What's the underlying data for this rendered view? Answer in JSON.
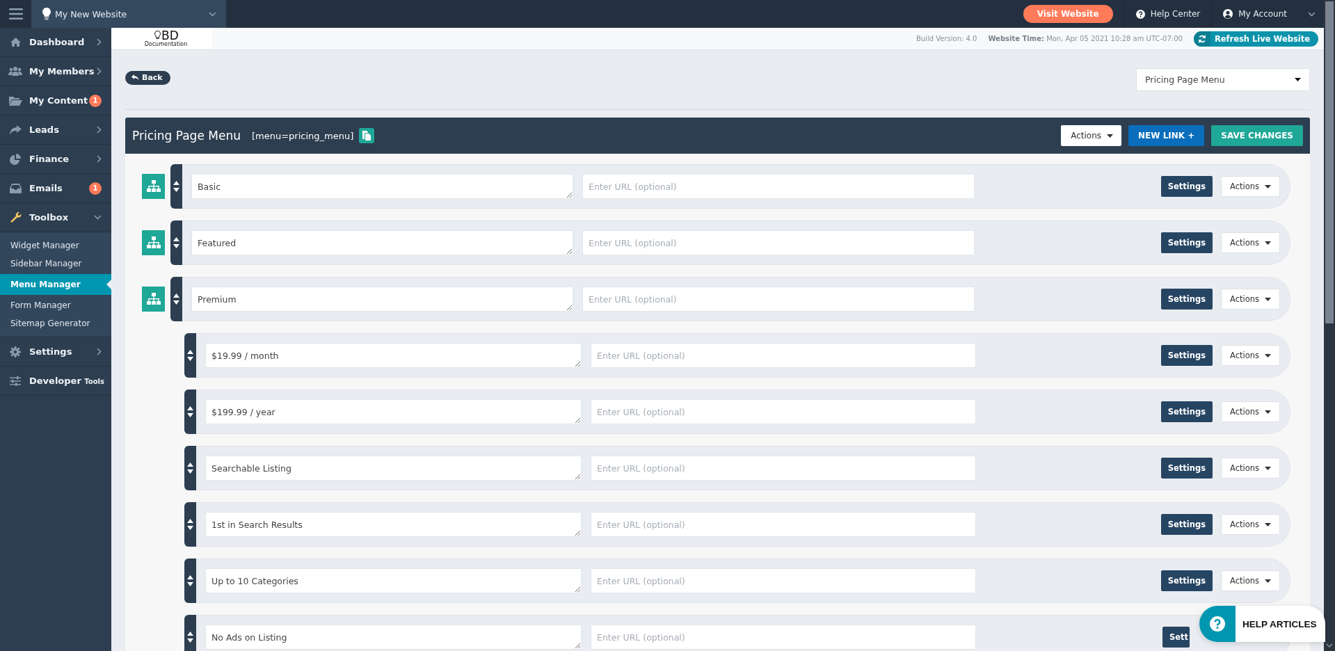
{
  "top_bar": {
    "site_name": "My New Website",
    "visit_button": "Visit Website",
    "help_link": "Help Center",
    "account_link": "My Account"
  },
  "sidebar": {
    "items": [
      {
        "label": "Dashboard",
        "expanded": false
      },
      {
        "label": "My Members",
        "expanded": false
      },
      {
        "label": "My Content",
        "badge": "1"
      },
      {
        "label": "Leads",
        "expanded": false
      },
      {
        "label": "Finance",
        "expanded": false
      },
      {
        "label": "Emails",
        "badge": "1"
      },
      {
        "label": "Toolbox",
        "expanded": true,
        "children": [
          {
            "label": "Widget Manager",
            "selected": false
          },
          {
            "label": "Sidebar Manager",
            "selected": false
          },
          {
            "label": "Menu Manager",
            "selected": true
          },
          {
            "label": "Form Manager",
            "selected": false
          },
          {
            "label": "Sitemap Generator",
            "selected": false
          }
        ]
      },
      {
        "label": "Settings",
        "expanded": false
      },
      {
        "label": "Developer",
        "suffix": "Tools"
      }
    ]
  },
  "header_strip": {
    "logo_mark": "BD",
    "logo_caption": "Documentation",
    "build_version": "Build Version: 4.0",
    "website_time_label": "Website Time:",
    "website_time": "Mon, Apr 05 2021 10:28 am UTC-07:00",
    "refresh_button": "Refresh Live Website"
  },
  "back_button": "Back",
  "menu_select": {
    "value": "Pricing Page Menu"
  },
  "panel": {
    "title": "Pricing Page Menu",
    "shortcode": "[menu=pricing_menu]",
    "actions_button": "Actions",
    "new_link_button": "NEW LINK +",
    "save_button": "SAVE CHANGES",
    "links": [
      {
        "name": "Basic",
        "url_placeholder": "Enter URL (optional)",
        "settings_button": "Settings",
        "actions_button": "Actions"
      },
      {
        "name": "Featured",
        "url_placeholder": "Enter URL (optional)",
        "settings_button": "Settings",
        "actions_button": "Actions"
      },
      {
        "name": "Premium",
        "url_placeholder": "Enter URL (optional)",
        "settings_button": "Settings",
        "actions_button": "Actions",
        "children": [
          {
            "name": "$19.99 / month",
            "url_placeholder": "Enter URL (optional)",
            "settings_button": "Settings",
            "actions_button": "Actions"
          },
          {
            "name": "$199.99 / year",
            "url_placeholder": "Enter URL (optional)",
            "settings_button": "Settings",
            "actions_button": "Actions"
          },
          {
            "name": "Searchable Listing",
            "url_placeholder": "Enter URL (optional)",
            "settings_button": "Settings",
            "actions_button": "Actions"
          },
          {
            "name": "1st in Search Results",
            "url_placeholder": "Enter URL (optional)",
            "settings_button": "Settings",
            "actions_button": "Actions"
          },
          {
            "name": "Up to 10 Categories",
            "url_placeholder": "Enter URL (optional)",
            "settings_button": "Settings",
            "actions_button": "Actions"
          },
          {
            "name": "No Ads on Listing",
            "url_placeholder": "Enter URL (optional)",
            "settings_button": "Sett"
          }
        ]
      }
    ]
  },
  "help_widget": {
    "label": "HELP ARTICLES"
  }
}
